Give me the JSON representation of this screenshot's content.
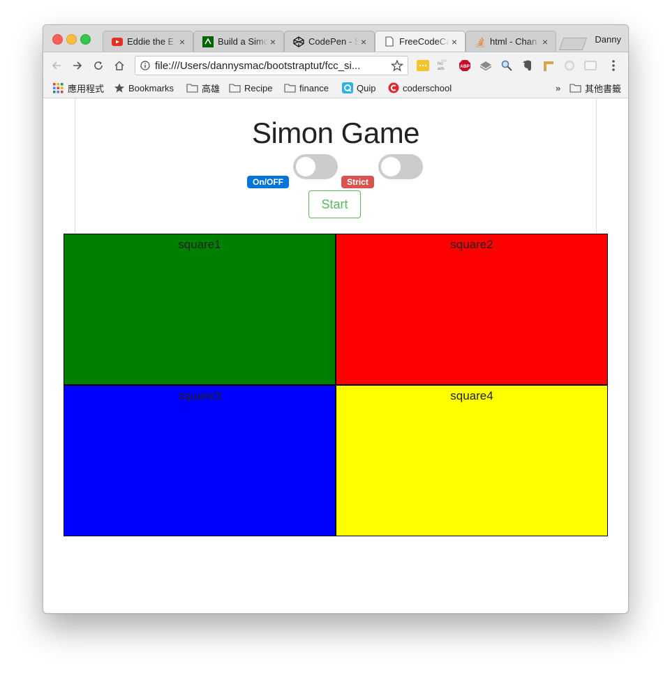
{
  "browser": {
    "profile_name": "Danny",
    "tabs": [
      {
        "title": "Eddie the E",
        "icon": "youtube-icon"
      },
      {
        "title": "Build a Simon",
        "icon": "fcc-icon"
      },
      {
        "title": "CodePen - S",
        "icon": "codepen-icon"
      },
      {
        "title": "FreeCodeCa",
        "icon": "file-icon",
        "active": true
      },
      {
        "title": "html - Chan",
        "icon": "stackoverflow-icon"
      }
    ],
    "address_bar": {
      "url": "file:///Users/dannysmac/bootstraptut/fcc_si..."
    },
    "extensions": {
      "no_ads_label": "No ads",
      "abp_label": "ABP"
    },
    "bookmarks": {
      "apps": "應用程式",
      "items": [
        "Bookmarks",
        "高雄",
        "Recipe",
        "finance",
        "Quip",
        "coderschool"
      ],
      "overflow": "»",
      "other": "其他書籤"
    }
  },
  "page": {
    "title": "Simon Game",
    "on_off_label": "On/OFF",
    "strict_label": "Strict",
    "start_label": "Start",
    "squares": [
      {
        "label": "square1",
        "color": "#008000"
      },
      {
        "label": "square2",
        "color": "#ff0000"
      },
      {
        "label": "square3",
        "color": "#0000ff"
      },
      {
        "label": "square4",
        "color": "#ffff00"
      }
    ],
    "switches": {
      "power_on": false,
      "strict_on": false
    }
  }
}
